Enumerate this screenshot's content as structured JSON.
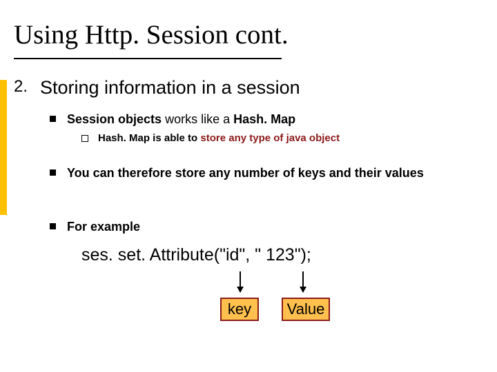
{
  "title": "Using Http. Session cont.",
  "list_number": "2.",
  "heading": "Storing information in a session",
  "bullets": {
    "b1_pre": "Session objects",
    "b1_mid": " works like a ",
    "b1_post": "Hash. Map",
    "b1a_pre": "Hash. Map is able to ",
    "b1a_em": "store any type of java object",
    "b2": "You can therefore store any number of keys and their values",
    "b3": "For example"
  },
  "code_line": "ses. set. Attribute(\"id\", \" 123\");",
  "box_key": "key",
  "box_value": "Value"
}
